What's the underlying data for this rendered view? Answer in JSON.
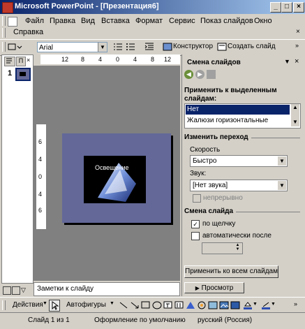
{
  "window": {
    "title": "Microsoft PowerPoint - [Презентация6]",
    "minimize": "_",
    "maximize": "□",
    "close": "×"
  },
  "menu": {
    "items": [
      "Файл",
      "Правка",
      "Вид",
      "Вставка",
      "Формат",
      "Сервис",
      "Показ слайдов",
      "Окно"
    ],
    "second_row": [
      "Справка"
    ]
  },
  "toolbar": {
    "font_name": "Arial",
    "designer": "Конструктор",
    "new_slide": "Создать слайд"
  },
  "left_pane": {
    "tabs": [
      "",
      "П"
    ],
    "slide_number": "1"
  },
  "ruler": {
    "top_ticks": [
      "12",
      "8",
      "4",
      "0",
      "4",
      "8",
      "12"
    ],
    "left_ticks": [
      "6",
      "4",
      "0",
      "4",
      "6"
    ]
  },
  "slide": {
    "thumb_title": "Освещение"
  },
  "notes": {
    "placeholder": "Заметки к слайду"
  },
  "task_pane": {
    "title": "Смена слайдов",
    "apply_to_label": "Применить к выделенным слайдам:",
    "transitions": [
      "Нет",
      "Жалюзи горизонтальные"
    ],
    "selected_transition": "Нет",
    "modify_section": "Изменить переход",
    "speed_label": "Скорость",
    "speed_value": "Быстро",
    "sound_label": "Звук:",
    "sound_value": "[Нет звука]",
    "loop_label": "непрерывно",
    "advance_section": "Смена слайда",
    "on_click_label": "по щелчку",
    "on_click_checked": true,
    "auto_label": "автоматически после",
    "apply_all_button": "Применить ко всем слайдам",
    "play_button": "Просмотр"
  },
  "drawing_toolbar": {
    "actions": "Действия",
    "autoshapes": "Автофигуры"
  },
  "status": {
    "slide": "Слайд 1 из 1",
    "design": "Оформление по умолчанию",
    "language": "русский (Россия)"
  }
}
